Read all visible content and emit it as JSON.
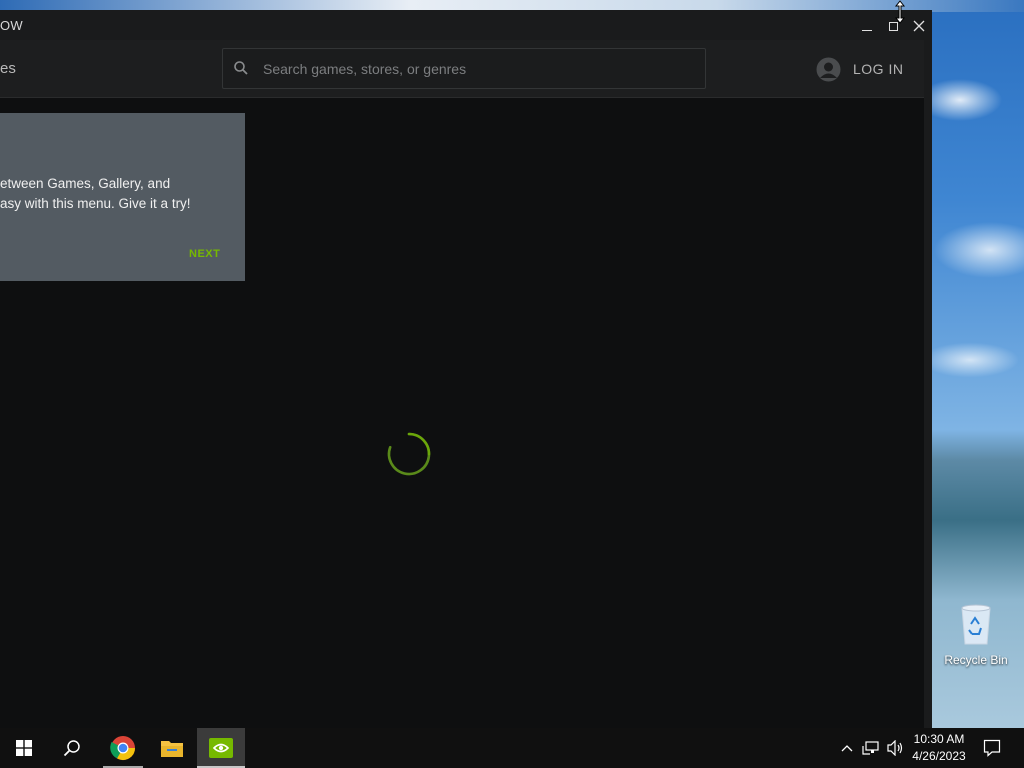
{
  "window": {
    "title_partial": "OW",
    "controls": {
      "minimize": "minimize",
      "maximize": "maximize",
      "close": "close"
    }
  },
  "nav": {
    "partial_tab": "es",
    "search_placeholder": "Search games, stores, or genres",
    "login_label": "LOG IN"
  },
  "tooltip": {
    "line1": "etween Games, Gallery, and",
    "line2": "asy with this menu. Give it a try!",
    "next_label": "NEXT"
  },
  "loading": {
    "spinner": "loading-spinner"
  },
  "desktop": {
    "icons": [
      {
        "label": "Recycle Bin",
        "icon": "recycle-bin-icon"
      }
    ]
  },
  "taskbar": {
    "apps": [
      "windows-start-icon",
      "search-icon",
      "chrome-icon",
      "file-explorer-icon",
      "nvidia-icon"
    ],
    "clock_time": "10:30 AM",
    "clock_date": "4/26/2023"
  },
  "colors": {
    "accent_green": "#76b900",
    "content_bg": "#0e0f10",
    "navbar_bg": "#1d1e1f",
    "tooltip_bg": "#535b62",
    "taskbar_bg": "#101010"
  }
}
